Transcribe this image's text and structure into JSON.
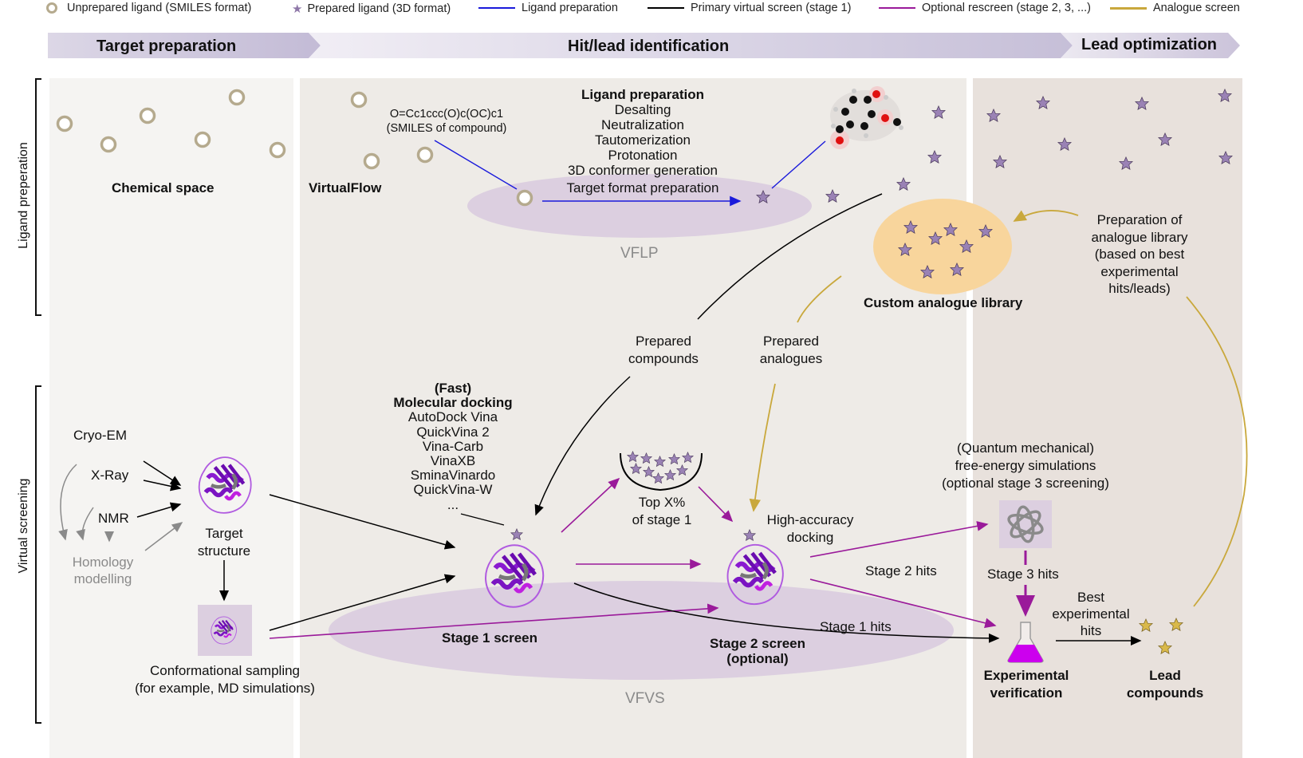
{
  "legend": {
    "unprepared_ligand": "Unprepared ligand (SMILES format)",
    "prepared_ligand": "Prepared ligand (3D format)",
    "ligand_preparation": "Ligand preparation",
    "primary_screen": "Primary virtual screen (stage 1)",
    "optional_rescreen": "Optional rescreen (stage 2, 3, ...)",
    "analogue_screen": "Analogue screen",
    "colors": {
      "ligand_preparation": "#1a1adb",
      "primary_screen": "#000000",
      "optional_rescreen": "#9a1a9a",
      "analogue_screen": "#c9a83c"
    }
  },
  "banners": {
    "target_preparation": "Target preparation",
    "hit_lead_identification": "Hit/lead identification",
    "lead_optimization": "Lead optimization"
  },
  "side_labels": {
    "ligand_preparation": "Ligand preperation",
    "virtual_screening": "Virtual screening"
  },
  "ligand_section": {
    "chemical_space": "Chemical space",
    "virtualflow": "VirtualFlow",
    "smiles": "O=Cc1ccc(O)c(OC)c1",
    "smiles_caption": "(SMILES of compound)",
    "prep_title": "Ligand preparation",
    "prep_steps": [
      "Desalting",
      "Neutralization",
      "Tautomerization",
      "Protonation",
      "3D conformer generation",
      "Target format preparation"
    ],
    "vflp": "VFLP",
    "custom_library": "Custom analogue library",
    "analogue_prep": [
      "Preparation of",
      "analogue library",
      "(based on best",
      "experimental",
      "hits/leads)"
    ]
  },
  "screening_section": {
    "prepared_compounds": [
      "Prepared",
      "compounds"
    ],
    "prepared_analogues": [
      "Prepared",
      "analogues"
    ],
    "sources": [
      "Cryo-EM",
      "X-Ray",
      "NMR"
    ],
    "homology": [
      "Homology",
      "modelling"
    ],
    "target_structure": [
      "Target",
      "structure"
    ],
    "conformational": [
      "Conformational sampling",
      "(for example, MD simulations)"
    ],
    "docking_title": [
      "(Fast)",
      "Molecular docking"
    ],
    "docking_programs": [
      "AutoDock Vina",
      "QuickVina 2",
      "Vina-Carb",
      "VinaXB",
      "SminaVinardo",
      "QuickVina-W",
      "..."
    ],
    "top_x": [
      "Top X%",
      "of stage 1"
    ],
    "high_accuracy": [
      "High-accuracy",
      "docking"
    ],
    "stage1_screen": "Stage 1 screen",
    "stage2_screen": [
      "Stage 2 screen",
      "(optional)"
    ],
    "vfvs": "VFVS",
    "qm": [
      "(Quantum mechanical)",
      "free-energy simulations",
      "(optional stage 3 screening)"
    ],
    "stage2_hits": "Stage 2 hits",
    "stage3_hits": "Stage 3 hits",
    "stage1_hits": "Stage 1 hits",
    "best_hits": [
      "Best",
      "experimental",
      "hits"
    ],
    "experimental": [
      "Experimental",
      "verification"
    ],
    "lead": [
      "Lead",
      "compounds"
    ]
  }
}
